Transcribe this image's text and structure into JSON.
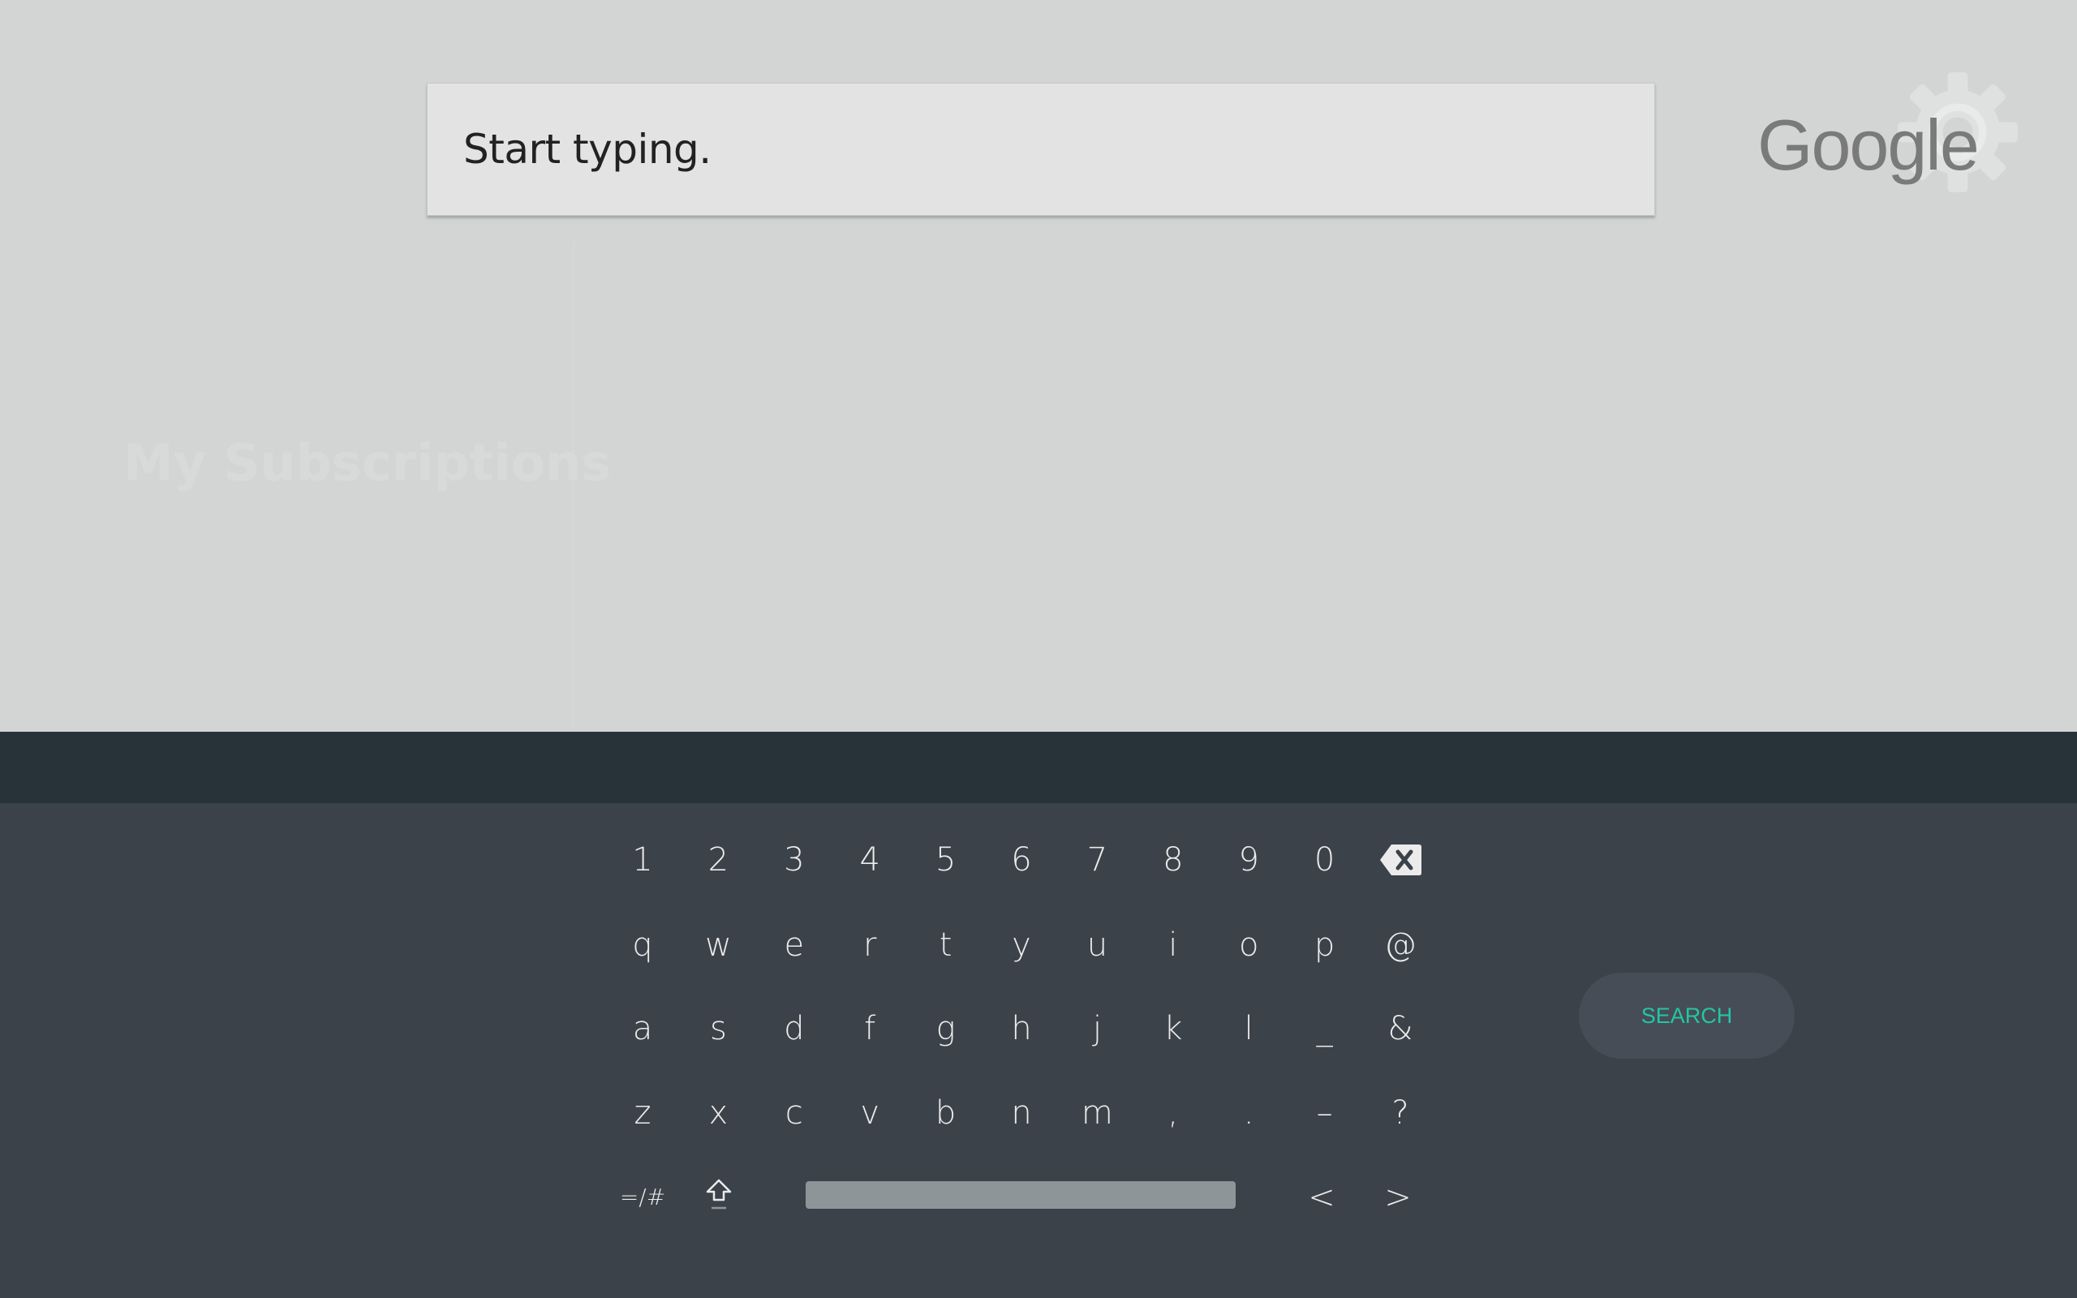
{
  "search": {
    "placeholder": "Start typing."
  },
  "background": {
    "faded_heading": "My Subscriptions"
  },
  "brand": {
    "logo_text": "Google",
    "settings_icon": "gear-icon"
  },
  "keyboard": {
    "rows": [
      [
        "1",
        "2",
        "3",
        "4",
        "5",
        "6",
        "7",
        "8",
        "9",
        "0"
      ],
      [
        "q",
        "w",
        "e",
        "r",
        "t",
        "y",
        "u",
        "i",
        "o",
        "p",
        "@"
      ],
      [
        "a",
        "s",
        "d",
        "f",
        "g",
        "h",
        "j",
        "k",
        "l",
        "_",
        "&"
      ],
      [
        "z",
        "x",
        "c",
        "v",
        "b",
        "n",
        "m",
        ",",
        ".",
        "–",
        "?"
      ]
    ],
    "backspace_icon": "backspace-icon",
    "symbols_label": "=/#",
    "shift_icon": "shift-icon",
    "left_arrow": "<",
    "right_arrow": ">",
    "search_label": "SEARCH"
  },
  "colors": {
    "accent": "#21c7a5",
    "keyboard_bg": "#3b424a",
    "keyboard_bar": "#273339",
    "top_bg": "#d3d5d4"
  }
}
